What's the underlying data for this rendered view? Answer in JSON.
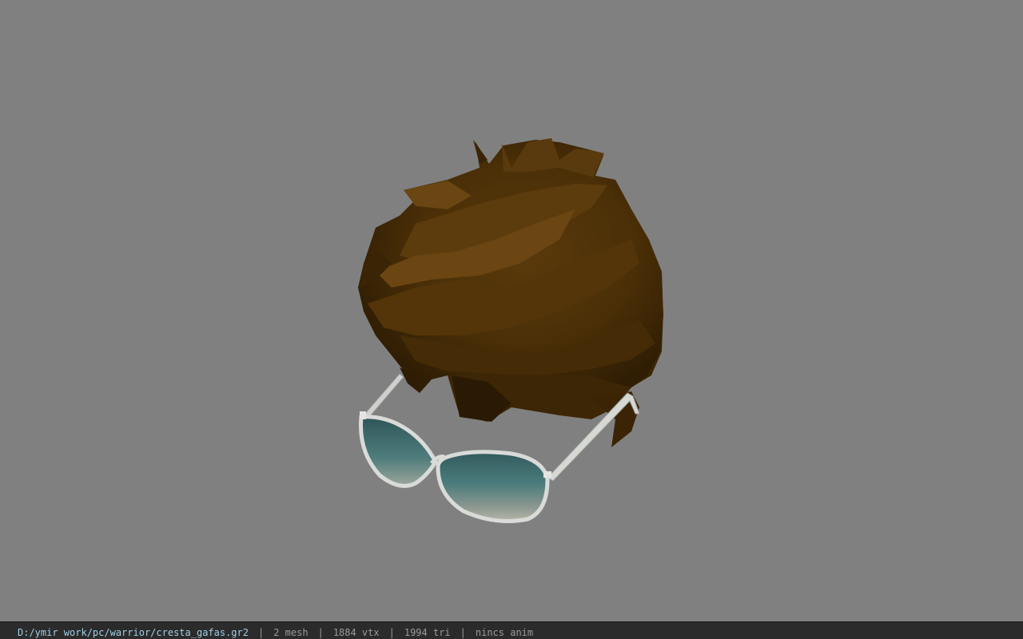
{
  "viewport": {
    "background_color": "#808080"
  },
  "model": {
    "hair_color": "#4a2f07",
    "hair_dark_color": "#2e1c04",
    "hair_light_color": "#6b4512",
    "glasses_frame_color": "#d9dbd8",
    "lens_color": "#3f6a6c"
  },
  "status": {
    "file_path": "D:/ymir work/pc/warrior/cresta_gafas.gr2",
    "separator": "|",
    "mesh_count": "2 mesh",
    "vertex_count": "1884 vtx",
    "triangle_count": "1994 tri",
    "animation": "nincs anim"
  }
}
